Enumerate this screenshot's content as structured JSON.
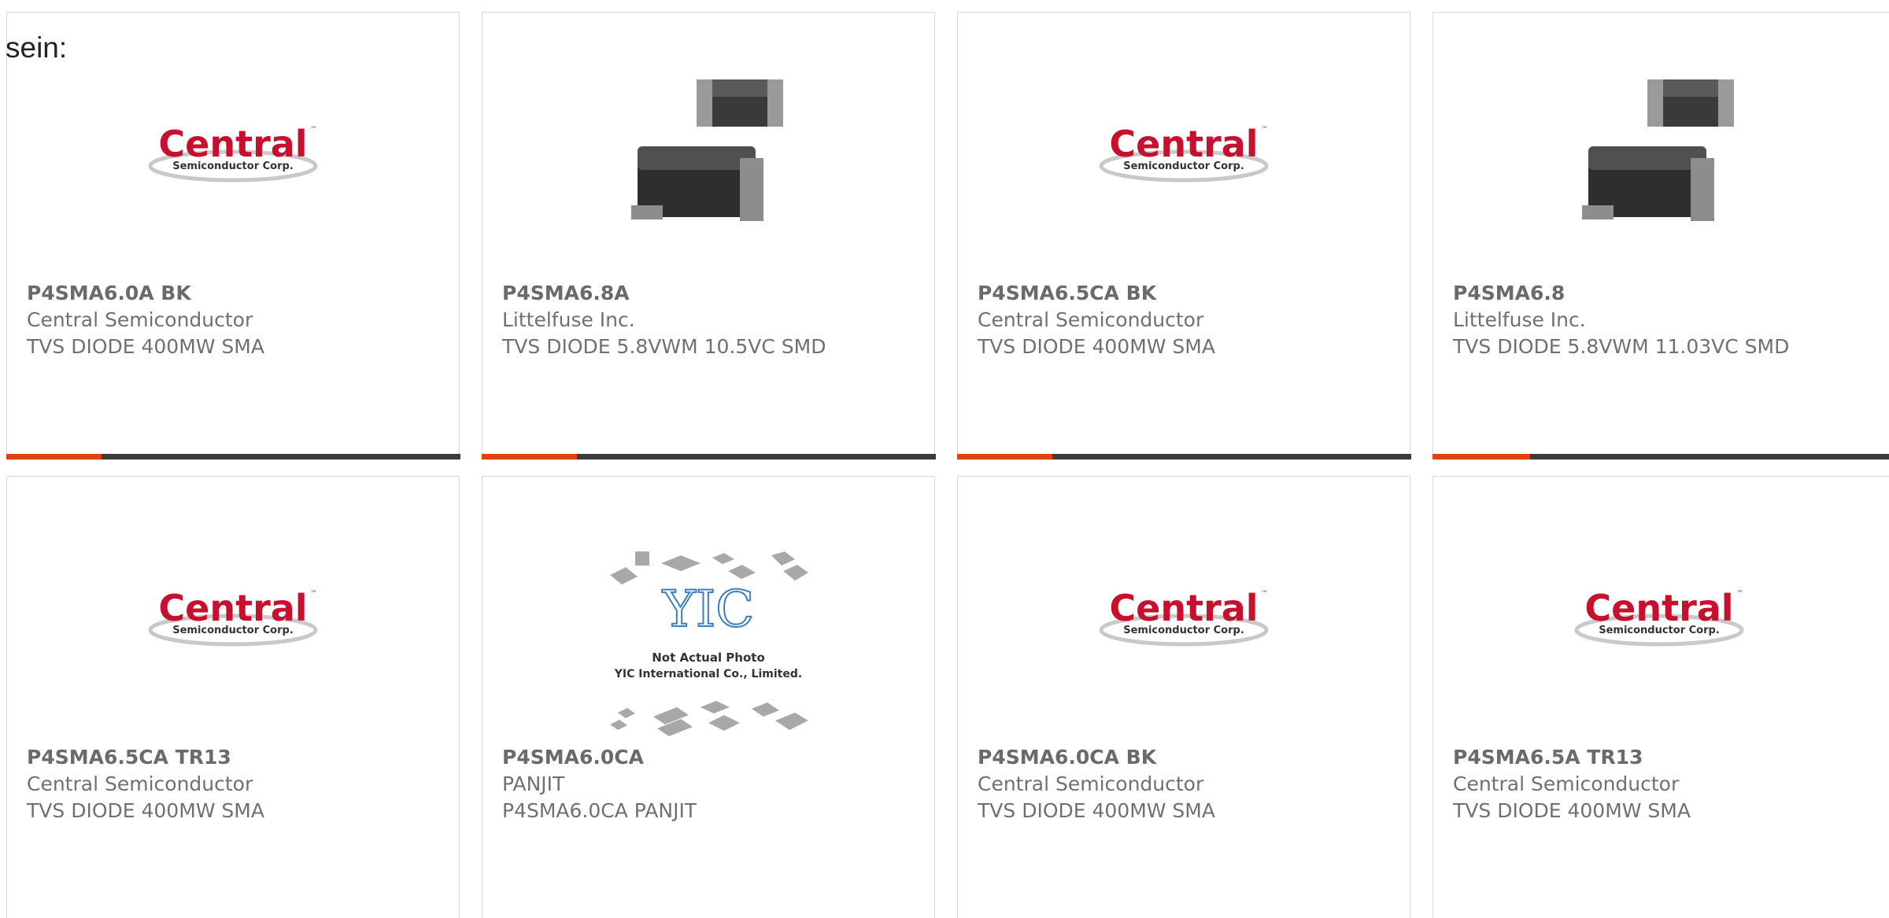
{
  "heading": "sein:",
  "logo_text": {
    "main": "Central",
    "sub": "Semiconductor Corp.",
    "tm": "™"
  },
  "yic_text": {
    "logo": "YIC",
    "line1": "Not Actual Photo",
    "line2": "YIC International Co., Limited."
  },
  "colors": {
    "accent": "#e0430f",
    "bar": "#3c3c3c",
    "logo_red": "#c8102e",
    "border": "#d6d6d6"
  },
  "products": [
    {
      "pn": "P4SMA6.0A BK",
      "mfr": "Central Semiconductor",
      "desc": "TVS DIODE 400MW SMA",
      "image": "central-logo",
      "progress": 0.21
    },
    {
      "pn": "P4SMA6.8A",
      "mfr": "Littelfuse Inc.",
      "desc": "TVS DIODE 5.8VWM 10.5VC SMD",
      "image": "sma-diode-photo",
      "progress": 0.21
    },
    {
      "pn": "P4SMA6.5CA BK",
      "mfr": "Central Semiconductor",
      "desc": "TVS DIODE 400MW SMA",
      "image": "central-logo",
      "progress": 0.21
    },
    {
      "pn": "P4SMA6.8",
      "mfr": "Littelfuse Inc.",
      "desc": "TVS DIODE 5.8VWM 11.03VC SMD",
      "image": "sma-diode-photo",
      "progress": 0.21
    },
    {
      "pn": "P4SMA6.5CA TR13",
      "mfr": "Central Semiconductor",
      "desc": "TVS DIODE 400MW SMA",
      "image": "central-logo"
    },
    {
      "pn": "P4SMA6.0CA",
      "mfr": "PANJIT",
      "desc": "P4SMA6.0CA PANJIT",
      "image": "yic-placeholder"
    },
    {
      "pn": "P4SMA6.0CA BK",
      "mfr": "Central Semiconductor",
      "desc": "TVS DIODE 400MW SMA",
      "image": "central-logo"
    },
    {
      "pn": "P4SMA6.5A TR13",
      "mfr": "Central Semiconductor",
      "desc": "TVS DIODE 400MW SMA",
      "image": "central-logo"
    }
  ]
}
